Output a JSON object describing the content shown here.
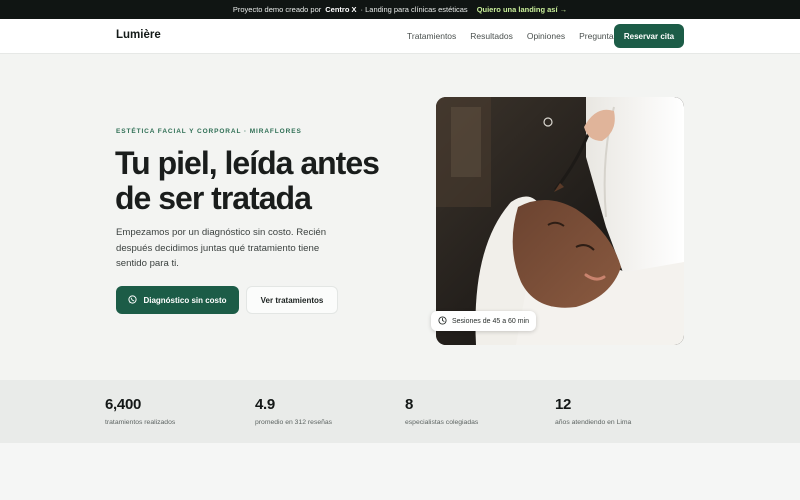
{
  "announcement": {
    "prefix": "Proyecto demo creado por",
    "brand": "Centro X",
    "suffix": "· Landing para clínicas estéticas",
    "link": "Quiero una landing así →"
  },
  "nav": {
    "logo": "Lumière",
    "links": [
      "Tratamientos",
      "Resultados",
      "Opiniones",
      "Preguntas"
    ],
    "cta": "Reservar cita"
  },
  "hero": {
    "eyebrow": "ESTÉTICA FACIAL Y CORPORAL · MIRAFLORES",
    "headline": "Tu piel, leída antes de ser tratada",
    "lead": "Empezamos por un diagnóstico sin costo. Recién después decidimos juntas qué tratamiento tiene sentido para ti.",
    "primary_button": "Diagnóstico sin costo",
    "secondary_button": "Ver tratamientos",
    "session_badge": "Sesiones de 45 a 60 min"
  },
  "stats": [
    {
      "value": "6,400",
      "label": "tratamientos realizados"
    },
    {
      "value": "4.9",
      "label": "promedio en 312 reseñas"
    },
    {
      "value": "8",
      "label": "especialistas colegiadas"
    },
    {
      "value": "12",
      "label": "años atendiendo en Lima"
    }
  ],
  "colors": {
    "brand_green": "#1c5c47",
    "announcement_bg": "#101513",
    "announcement_link": "#c9ef9a",
    "page_bg": "#f3f4f2"
  },
  "icons": {
    "primary_button": "whatsapp-icon",
    "session_badge": "clock-icon"
  }
}
